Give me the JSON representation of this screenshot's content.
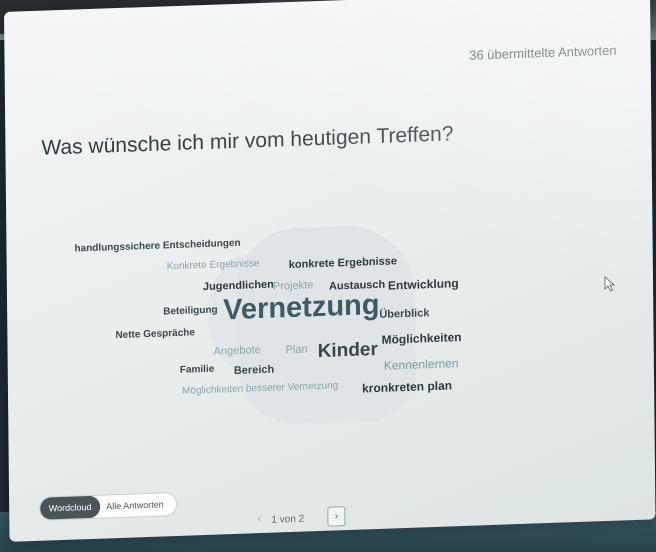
{
  "header": {
    "response_count": "36 übermittelte Antworten"
  },
  "question": "Was wünsche ich mir vom heutigen Treffen?",
  "wordcloud": {
    "words": [
      {
        "text": "handlungssichere Entscheidungen",
        "color": "#3b474c"
      },
      {
        "text": "Konkrete Ergebnisse",
        "color": "#8aa4ab"
      },
      {
        "text": "konkrete Ergebnisse",
        "color": "#2f3a3f"
      },
      {
        "text": "Jugendlichen",
        "color": "#2f3a3f"
      },
      {
        "text": "Projekte",
        "color": "#8aa4ab"
      },
      {
        "text": "Austausch",
        "color": "#2f3a3f"
      },
      {
        "text": "Entwicklung",
        "color": "#2f3a3f"
      },
      {
        "text": "Beteiligung",
        "color": "#3b474c"
      },
      {
        "text": "Vernetzung",
        "color": "#3e5a62"
      },
      {
        "text": "Überblick",
        "color": "#3b474c"
      },
      {
        "text": "Nette Gespräche",
        "color": "#3b474c"
      },
      {
        "text": "Möglichkeiten",
        "color": "#2f3a3f"
      },
      {
        "text": "Angebote",
        "color": "#8aa4ab"
      },
      {
        "text": "Plan",
        "color": "#8aa4ab"
      },
      {
        "text": "Kinder",
        "color": "#3b474c"
      },
      {
        "text": "Familie",
        "color": "#3b474c"
      },
      {
        "text": "Bereich",
        "color": "#3b474c"
      },
      {
        "text": "Kennenlernen",
        "color": "#7a9aa2"
      },
      {
        "text": "Möglichkeiten besserer Vernetzung",
        "color": "#8aa4ab"
      },
      {
        "text": "kronkreten plan",
        "color": "#2f3a3f"
      }
    ]
  },
  "view_toggle": {
    "active": "Wordcloud",
    "other": "Alle Antworten"
  },
  "pager": {
    "label": "1 von 2",
    "prev_icon": "chevron-left-icon",
    "next_icon": "chevron-right-icon"
  },
  "colors": {
    "screen_bg": "#eef1f1",
    "text_dark": "#2f3a3f",
    "text_light": "#8aa4ab",
    "accent": "#3e5a62"
  }
}
